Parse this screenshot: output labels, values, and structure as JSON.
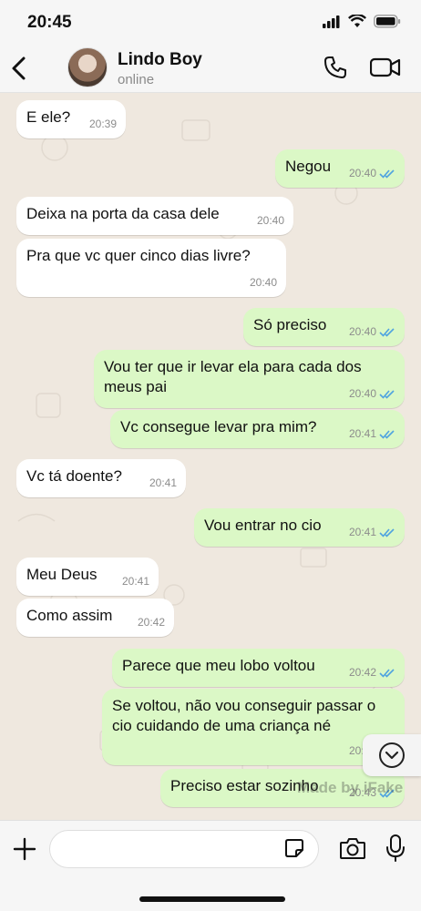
{
  "status_bar": {
    "time": "20:45"
  },
  "header": {
    "contact_name": "Lindo Boy",
    "contact_status": "online"
  },
  "messages": [
    {
      "dir": "in",
      "text": "E ele?",
      "time": "20:39"
    },
    {
      "dir": "out",
      "text": "Negou",
      "time": "20:40"
    },
    {
      "dir": "in",
      "text": "Deixa na porta da casa dele",
      "time": "20:40"
    },
    {
      "dir": "in",
      "text": "Pra que vc quer cinco dias livre?",
      "time": "20:40"
    },
    {
      "dir": "out",
      "text": "Só preciso",
      "time": "20:40"
    },
    {
      "dir": "out",
      "text": "Vou ter que ir levar ela para cada dos meus pai",
      "time": "20:40"
    },
    {
      "dir": "out",
      "text": "Vc consegue levar pra mim?",
      "time": "20:41"
    },
    {
      "dir": "in",
      "text": "Vc tá doente?",
      "time": "20:41"
    },
    {
      "dir": "out",
      "text": "Vou entrar no cio",
      "time": "20:41"
    },
    {
      "dir": "in",
      "text": "Meu Deus",
      "time": "20:41"
    },
    {
      "dir": "in",
      "text": "Como assim",
      "time": "20:42"
    },
    {
      "dir": "out",
      "text": "Parece que meu lobo voltou",
      "time": "20:42"
    },
    {
      "dir": "out",
      "text": "Se voltou, não vou conseguir passar o cio cuidando de uma criança né",
      "time": "20:42"
    },
    {
      "dir": "out",
      "text": "Preciso estar sozinho",
      "time": "20:43"
    }
  ],
  "watermark": "Made by iFake",
  "colors": {
    "incoming": "#ffffff",
    "outgoing": "#dbf8c6",
    "read_ticks": "#4fa3e0",
    "chat_bg": "#efe8df"
  },
  "icons": [
    "back-chevron-icon",
    "phone-icon",
    "video-camera-icon",
    "double-check-icon",
    "chevron-down-icon",
    "plus-icon",
    "sticker-icon",
    "camera-icon",
    "microphone-icon"
  ]
}
